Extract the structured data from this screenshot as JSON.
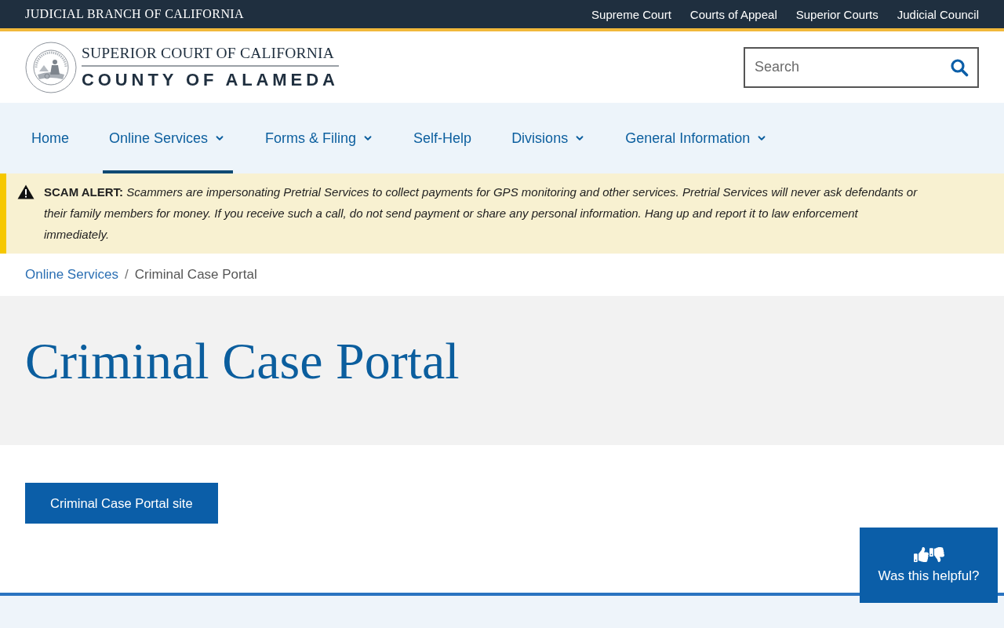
{
  "top_bar": {
    "title": "JUDICIAL BRANCH OF CALIFORNIA",
    "links": [
      "Supreme Court",
      "Courts of Appeal",
      "Superior Courts",
      "Judicial Council"
    ]
  },
  "header": {
    "logo": {
      "line_1": "SUPERIOR COURT OF CALIFORNIA",
      "line_2": "COUNTY OF ALAMEDA"
    },
    "search": {
      "placeholder": "Search"
    }
  },
  "nav": {
    "items": [
      {
        "label": "Home",
        "dropdown": false,
        "selected": false
      },
      {
        "label": "Online Services",
        "dropdown": true,
        "selected": true
      },
      {
        "label": "Forms & Filing",
        "dropdown": true,
        "selected": false
      },
      {
        "label": "Self-Help",
        "dropdown": false,
        "selected": false
      },
      {
        "label": "Divisions",
        "dropdown": true,
        "selected": false
      },
      {
        "label": "General Information",
        "dropdown": true,
        "selected": false
      }
    ]
  },
  "alert": {
    "text": "**SCAM ALERT:** *Scammers are impersonating Pretrial Services to collect payments for GPS monitoring and other services. Pretrial Services will never ask defendants or their family members for money. If you receive such a call, do not send payment or share any personal information. Hang up and report it to law enforcement immediately.*"
  },
  "breadcrumb": {
    "separator": "/",
    "items": [
      {
        "label": "Online Services",
        "kind": "link"
      },
      {
        "label": "Criminal Case Portal",
        "kind": "current"
      }
    ]
  },
  "page_title": "Criminal Case Portal",
  "content": {
    "button": "Criminal Case Portal site"
  },
  "feedback": {
    "label": "Was this helpful?"
  }
}
